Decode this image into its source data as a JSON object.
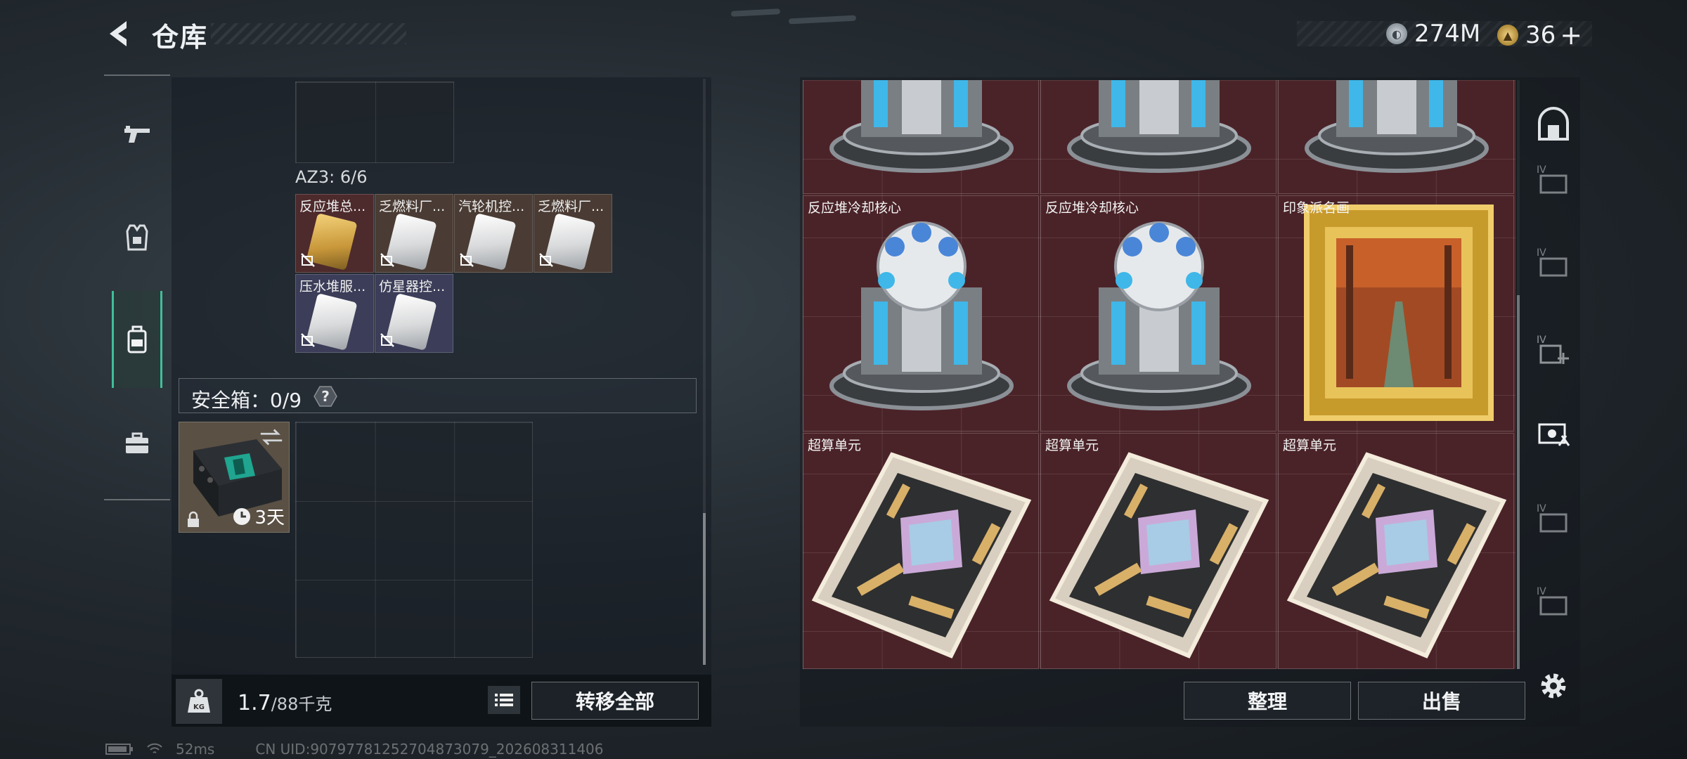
{
  "header": {
    "title": "仓库",
    "currency_silver": "274M",
    "currency_gold": "36",
    "currency_gold_plus": "+"
  },
  "nav": {
    "items": [
      "weapon",
      "armor",
      "backpack",
      "toolbox"
    ],
    "active": "backpack"
  },
  "container": {
    "az3_label": "AZ3: 6/6",
    "items": [
      {
        "name": "反应堆总...",
        "bg": "red",
        "card": "gold"
      },
      {
        "name": "乏燃料厂...",
        "bg": "brown",
        "card": "white"
      },
      {
        "name": "汽轮机控...",
        "bg": "brown",
        "card": "white"
      },
      {
        "name": "乏燃料厂...",
        "bg": "brown",
        "card": "white"
      },
      {
        "name": "压水堆服...",
        "bg": "blue",
        "card": "white"
      },
      {
        "name": "仿星器控...",
        "bg": "blue",
        "card": "white"
      }
    ]
  },
  "safe": {
    "label": "安全箱：0/9",
    "help": "?",
    "duration": "3天"
  },
  "bottom_left": {
    "weight_current": "1.7",
    "weight_max": "/88千克",
    "transfer_all": "转移全部"
  },
  "stash": {
    "items": [
      {
        "label": "",
        "type": "reactor"
      },
      {
        "label": "",
        "type": "reactor"
      },
      {
        "label": "",
        "type": "reactor"
      },
      {
        "label": "反应堆冷却核心",
        "type": "reactor"
      },
      {
        "label": "反应堆冷却核心",
        "type": "reactor"
      },
      {
        "label": "印象派名画",
        "type": "painting"
      },
      {
        "label": "超算单元",
        "type": "chip"
      },
      {
        "label": "超算单元",
        "type": "chip"
      },
      {
        "label": "超算单元",
        "type": "chip"
      }
    ]
  },
  "bottom_right": {
    "sort": "整理",
    "sell": "出售"
  },
  "status": {
    "latency": "52ms",
    "uid": "CN UID:9079778125270487307​9_202608311406"
  },
  "colors": {
    "accent": "#3fbf9a",
    "stash_bg": "#4a2328",
    "rarity_red": "#4d2a2c",
    "rarity_gold": "#c8973a"
  }
}
